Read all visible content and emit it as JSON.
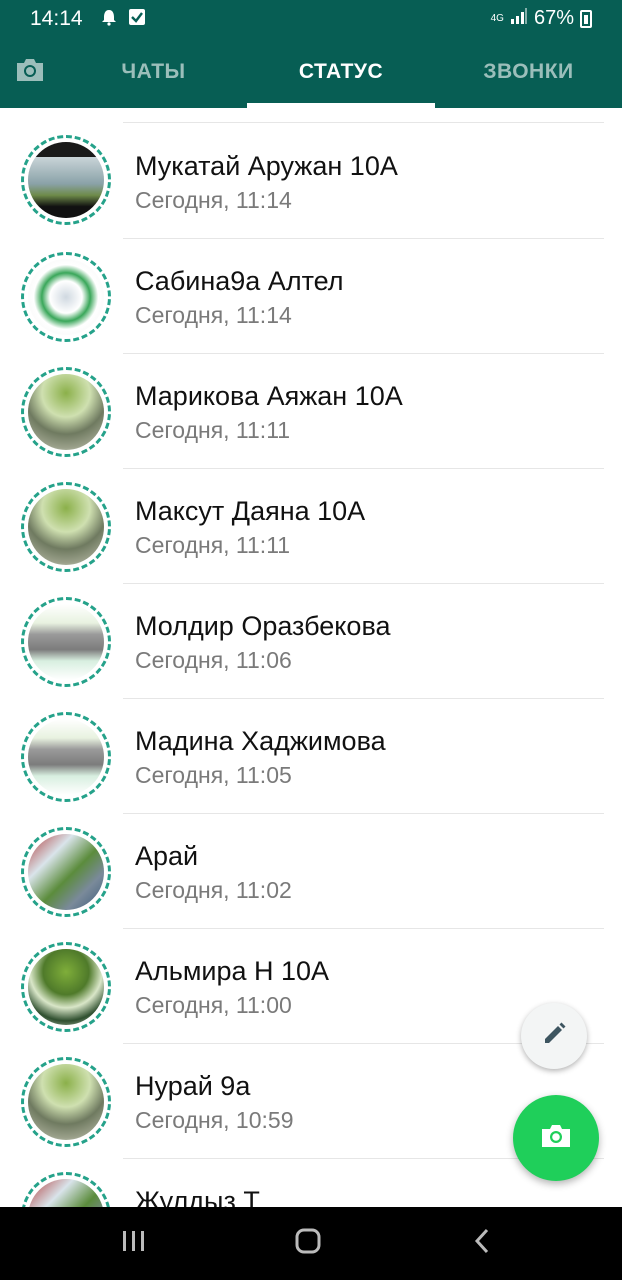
{
  "status_bar": {
    "time": "14:14",
    "network": "4G",
    "battery": "67%",
    "icons": [
      "alarm-icon",
      "checkbox-notification-icon",
      "signal-icon",
      "battery-icon"
    ]
  },
  "tabs": {
    "camera_icon": "camera-icon",
    "items": [
      {
        "label": "ЧАТЫ",
        "active": false
      },
      {
        "label": "СТАТУС",
        "active": true
      },
      {
        "label": "ЗВОНКИ",
        "active": false
      }
    ]
  },
  "colors": {
    "header": "#075E54",
    "ring": "#25A28A",
    "fab": "#1fcf5a"
  },
  "statuses": [
    {
      "name": "Мукатай Аружан 10А",
      "time": "Сегодня, 11:14"
    },
    {
      "name": "Сабина9а Алтел",
      "time": "Сегодня, 11:14"
    },
    {
      "name": "Марикова Аяжан 10А",
      "time": "Сегодня, 11:11"
    },
    {
      "name": "Максут Даяна 10А",
      "time": "Сегодня, 11:11"
    },
    {
      "name": "Молдир Оразбекова",
      "time": "Сегодня, 11:06"
    },
    {
      "name": "Мадина Хаджимова",
      "time": "Сегодня, 11:05"
    },
    {
      "name": "Арай",
      "time": "Сегодня, 11:02"
    },
    {
      "name": "Альмира Н 10А",
      "time": "Сегодня, 11:00"
    },
    {
      "name": "Нурай 9а",
      "time": "Сегодня, 10:59"
    },
    {
      "name": "Жулдыз Т",
      "time": ""
    }
  ],
  "fabs": {
    "edit_icon": "pencil-icon",
    "camera_icon": "camera-icon"
  },
  "nav": [
    "recent-apps-icon",
    "home-icon",
    "back-icon"
  ]
}
